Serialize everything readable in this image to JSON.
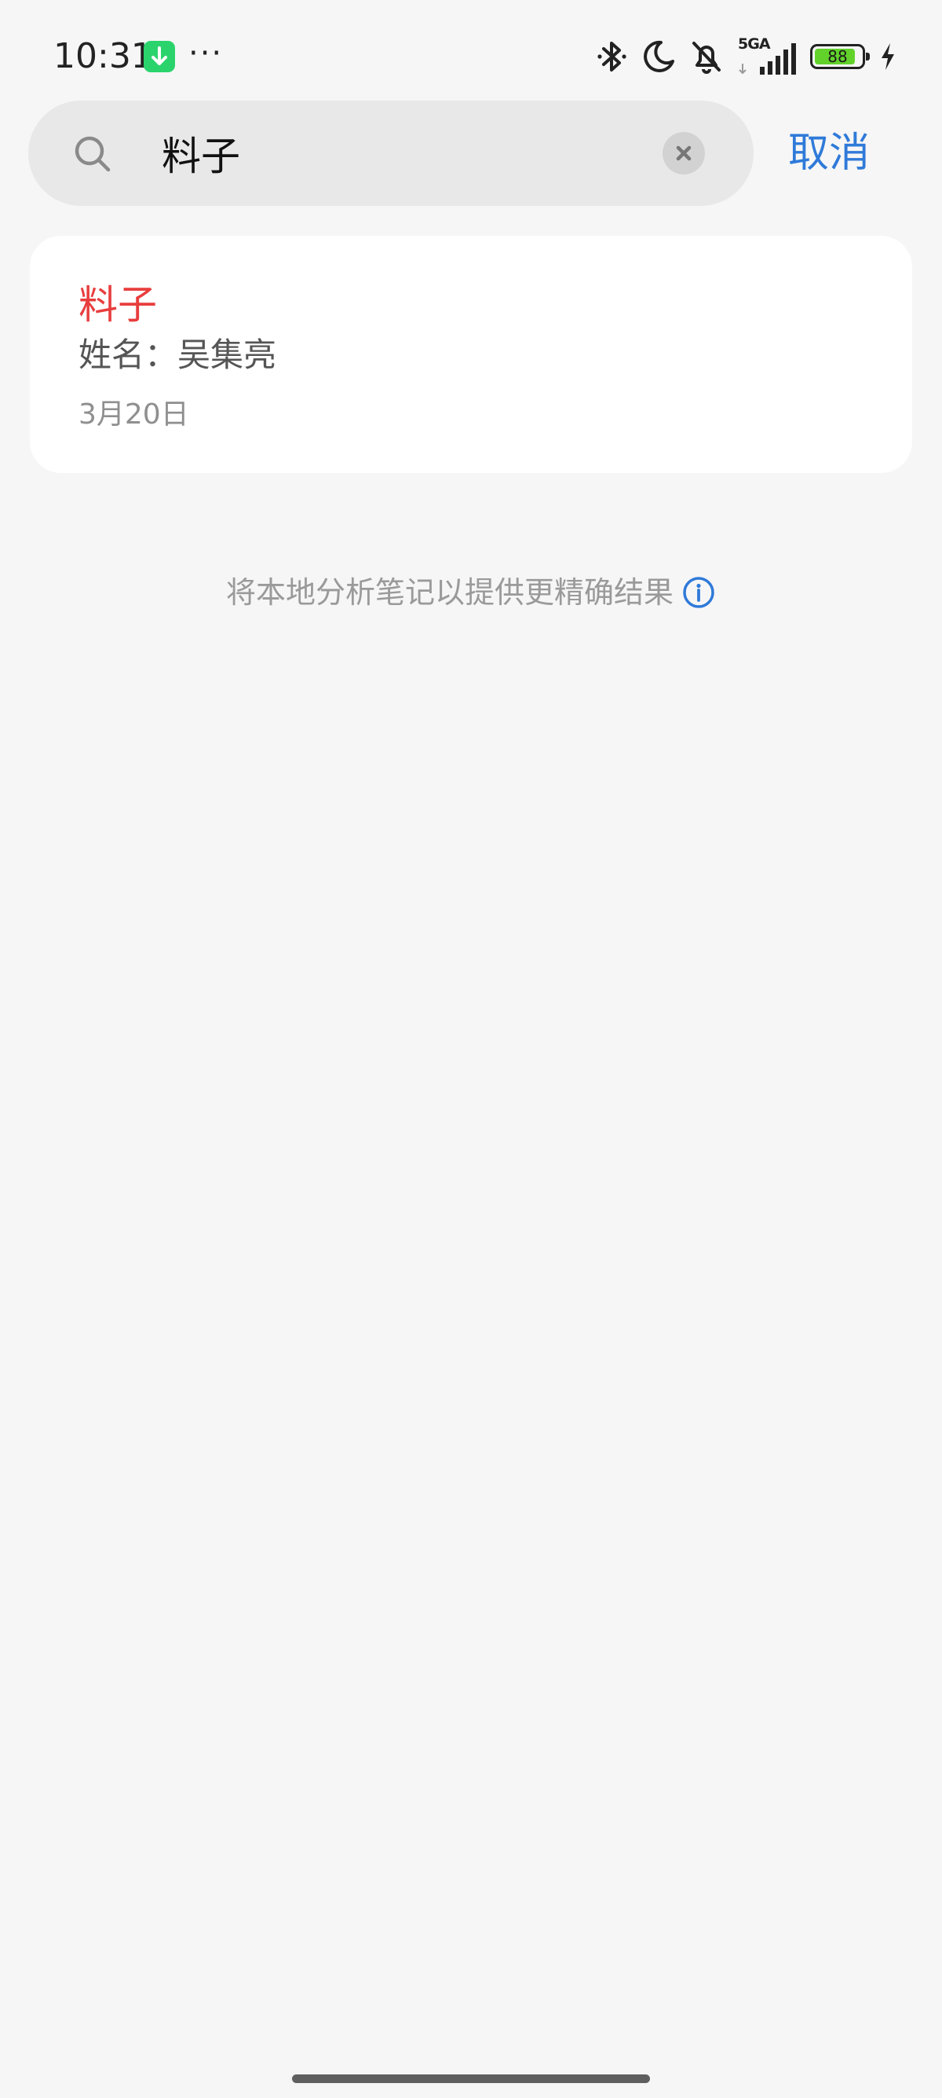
{
  "status_bar": {
    "time": "10:31",
    "network_label": "5GA",
    "battery_level": "88",
    "battery_percent": 88,
    "icons": [
      "download-app-icon",
      "more-dots-icon",
      "bluetooth-icon",
      "do-not-disturb-moon-icon",
      "silent-bell-icon",
      "signal-bars-icon",
      "battery-icon",
      "charging-bolt-icon"
    ],
    "more_dots": "···"
  },
  "search": {
    "query": "料子",
    "icon": "search-icon",
    "clear_icon": "clear-icon",
    "cancel_label": "取消"
  },
  "results": [
    {
      "title": "料子",
      "snippet": "姓名：吴集亮",
      "date": "3月20日"
    }
  ],
  "hint": {
    "text": "将本地分析笔记以提供更精确结果",
    "icon": "info-icon"
  },
  "colors": {
    "background": "#f6f6f6",
    "accent": "#2f7ad9",
    "highlight": "#e83d3d",
    "battery": "#62d22b",
    "app_badge": "#2bd36d"
  }
}
